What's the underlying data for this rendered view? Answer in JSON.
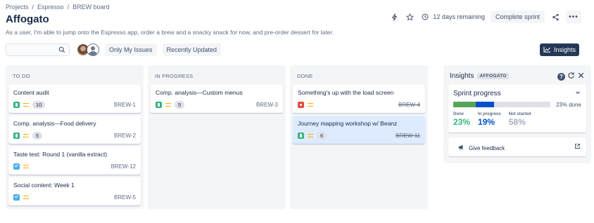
{
  "breadcrumb": {
    "items": [
      "Projects",
      "Espresso",
      "BREW board"
    ],
    "separator": "/"
  },
  "page": {
    "title": "Affogato",
    "subtitle": "As a user, I'm able to jump onto the Espresso app, order a brew and a snacky snack for now, and pre-order dessert for later."
  },
  "header": {
    "time_remaining": "12 days remaining",
    "complete_sprint_label": "Complete sprint",
    "more_label": "•••",
    "icons": [
      "lightning-icon",
      "star-icon",
      "clock-icon",
      "share-icon",
      "more-icon"
    ]
  },
  "toolbar": {
    "search_placeholder": "",
    "filter_only_my": "Only My Issues",
    "filter_recent": "Recently Updated",
    "insights_label": "Insights"
  },
  "columns": [
    {
      "title": "TO DO",
      "cards": [
        {
          "title": "Content audit",
          "type": "story",
          "points": "10",
          "key": "BREW-1"
        },
        {
          "title": "Comp. analysis—Food delivery",
          "type": "story",
          "points": "5",
          "key": "BREW-2"
        },
        {
          "title": "Taste test: Round 1 (vanilla extract)",
          "type": "task",
          "points": "",
          "key": "BREW-12"
        },
        {
          "title": "Social content: Week 1",
          "type": "task",
          "points": "",
          "key": "BREW-5"
        }
      ]
    },
    {
      "title": "IN PROGRESS",
      "cards": [
        {
          "title": "Comp. analysis—Custom menus",
          "type": "story",
          "points": "5",
          "key": "BREW-3"
        }
      ]
    },
    {
      "title": "DONE",
      "cards": [
        {
          "title": "Something's up with the load screen",
          "type": "bug",
          "points": "",
          "key": "BREW-4"
        },
        {
          "title": "Journey mapping workshop w/ Beanz",
          "type": "story",
          "points": "6",
          "key": "BREW-11"
        }
      ]
    }
  ],
  "insights": {
    "title": "Insights",
    "tag": "AFFOGATO",
    "sprint_progress": {
      "title": "Sprint progress",
      "percent_done_label": "23% done",
      "done_fraction": 0.23,
      "in_progress_fraction": 0.19,
      "stats": [
        {
          "label": "Done",
          "value": "23%"
        },
        {
          "label": "In progress",
          "value": "19%"
        },
        {
          "label": "Not started",
          "value": "58%"
        }
      ]
    },
    "feedback_label": "Give feedback"
  },
  "colors": {
    "accent_dark": "#253858",
    "done_green": "#36b37e",
    "progress_blue": "#0052cc",
    "not_started_gray": "#a5adba",
    "highlight_card": "#deebff"
  }
}
